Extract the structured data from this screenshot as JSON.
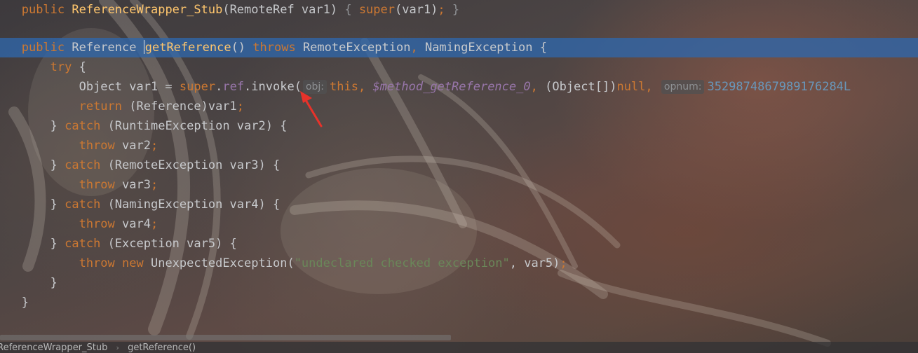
{
  "code": {
    "line1": {
      "kw_public": "public",
      "ctor": "ReferenceWrapper_Stub",
      "params": "(RemoteRef var1) ",
      "brace_open": "{ ",
      "kw_super": "super",
      "args": "(var1)",
      "semi": "; ",
      "brace_close": "}"
    },
    "line2": {
      "kw_public": "public",
      "ret_type": " Reference ",
      "method": "getReference",
      "parens": "() ",
      "kw_throws": "throws",
      "ex1": " RemoteException",
      "comma": ",",
      "ex2": " NamingException {"
    },
    "line3": {
      "kw_try": "try",
      "rest": " {"
    },
    "line4": {
      "decl": "Object var1 = ",
      "kw_super": "super",
      "dot1": ".",
      "field_ref": "ref",
      "call": ".invoke(",
      "hint_obj": "obj:",
      "kw_this": "this",
      "comma1": ", ",
      "static_field": "$method_getReference_0",
      "comma2": ", ",
      "cast": "(Object[])",
      "kw_null": "null",
      "comma3": ", ",
      "hint_opnum": "opnum:",
      "number": "3529874867989176284L"
    },
    "line5": {
      "kw_return": "return",
      "rest": " (Reference)var1",
      "semi": ";"
    },
    "line6": {
      "prefix": "} ",
      "kw_catch": "catch",
      "rest": " (RuntimeException var2) {"
    },
    "line7": {
      "kw_throw": "throw",
      "rest": " var2",
      "semi": ";"
    },
    "line8": {
      "prefix": "} ",
      "kw_catch": "catch",
      "rest": " (RemoteException var3) {"
    },
    "line9": {
      "kw_throw": "throw",
      "rest": " var3",
      "semi": ";"
    },
    "line10": {
      "prefix": "} ",
      "kw_catch": "catch",
      "rest": " (NamingException var4) {"
    },
    "line11": {
      "kw_throw": "throw",
      "rest": " var4",
      "semi": ";"
    },
    "line12": {
      "prefix": "} ",
      "kw_catch": "catch",
      "rest": " (Exception var5) {"
    },
    "line13": {
      "kw_throw": "throw",
      "sp": " ",
      "kw_new": "new",
      "cls": " UnexpectedException(",
      "str": "\"undeclared checked exception\"",
      "rest": ", var5)",
      "semi": ";"
    },
    "line14": {
      "text": "}"
    },
    "line15": {
      "text": "}"
    }
  },
  "breadcrumb": {
    "items": [
      "ReferenceWrapper_Stub",
      "getReference()"
    ],
    "separator": "›"
  },
  "colors": {
    "keyword": "#cc7832",
    "method_decl": "#ffc66d",
    "field": "#9876aa",
    "string": "#6a8759",
    "number": "#6897bb",
    "current_line": "#3066aa",
    "annotation_arrow": "#e8322a"
  }
}
